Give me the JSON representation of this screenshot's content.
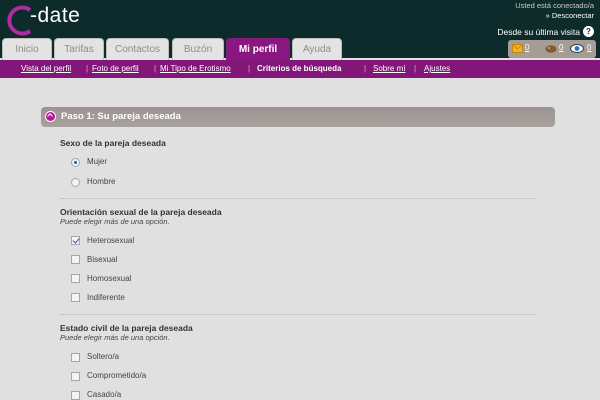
{
  "brand": {
    "logo_text": "-date",
    "accent": "#88187f"
  },
  "header": {
    "connected_text": "Usted está conectado/a",
    "logout_label": "» Desconectar",
    "since_text": "Desde su última visita",
    "help_icon": "?"
  },
  "tabs": [
    {
      "label": "Inicio"
    },
    {
      "label": "Tarifas"
    },
    {
      "label": "Contactos"
    },
    {
      "label": "Buzón"
    },
    {
      "label": "Mi perfil",
      "active": true
    },
    {
      "label": "Ayuda"
    }
  ],
  "counters": {
    "messages": "0",
    "gifts": "0",
    "views": "0"
  },
  "subnav": [
    {
      "label": "Vista del perfil"
    },
    {
      "label": "Foto de perfil"
    },
    {
      "label": "Mi Tipo de Erotismo"
    },
    {
      "label": "Criterios de búsqueda",
      "active": true
    },
    {
      "label": "Sobre mí"
    },
    {
      "label": "Ajustes"
    }
  ],
  "step": {
    "title": "Paso 1: Su pareja deseada"
  },
  "sections": {
    "sex": {
      "title": "Sexo de la pareja deseada",
      "options": [
        {
          "label": "Mujer",
          "checked": true
        },
        {
          "label": "Hombre",
          "checked": false
        }
      ]
    },
    "orientation": {
      "title": "Orientación sexual de la pareja deseada",
      "hint": "Puede elegir más de una opción.",
      "options": [
        {
          "label": "Heterosexual",
          "checked": true
        },
        {
          "label": "Bisexual",
          "checked": false
        },
        {
          "label": "Homosexual",
          "checked": false
        },
        {
          "label": "Indiferente",
          "checked": false
        }
      ]
    },
    "civil": {
      "title": "Estado civil de la pareja deseada",
      "hint": "Puede elegir más de una opción.",
      "options": [
        {
          "label": "Soltero/a",
          "checked": false
        },
        {
          "label": "Comprometido/a",
          "checked": false
        },
        {
          "label": "Casado/a",
          "checked": false
        }
      ]
    }
  }
}
